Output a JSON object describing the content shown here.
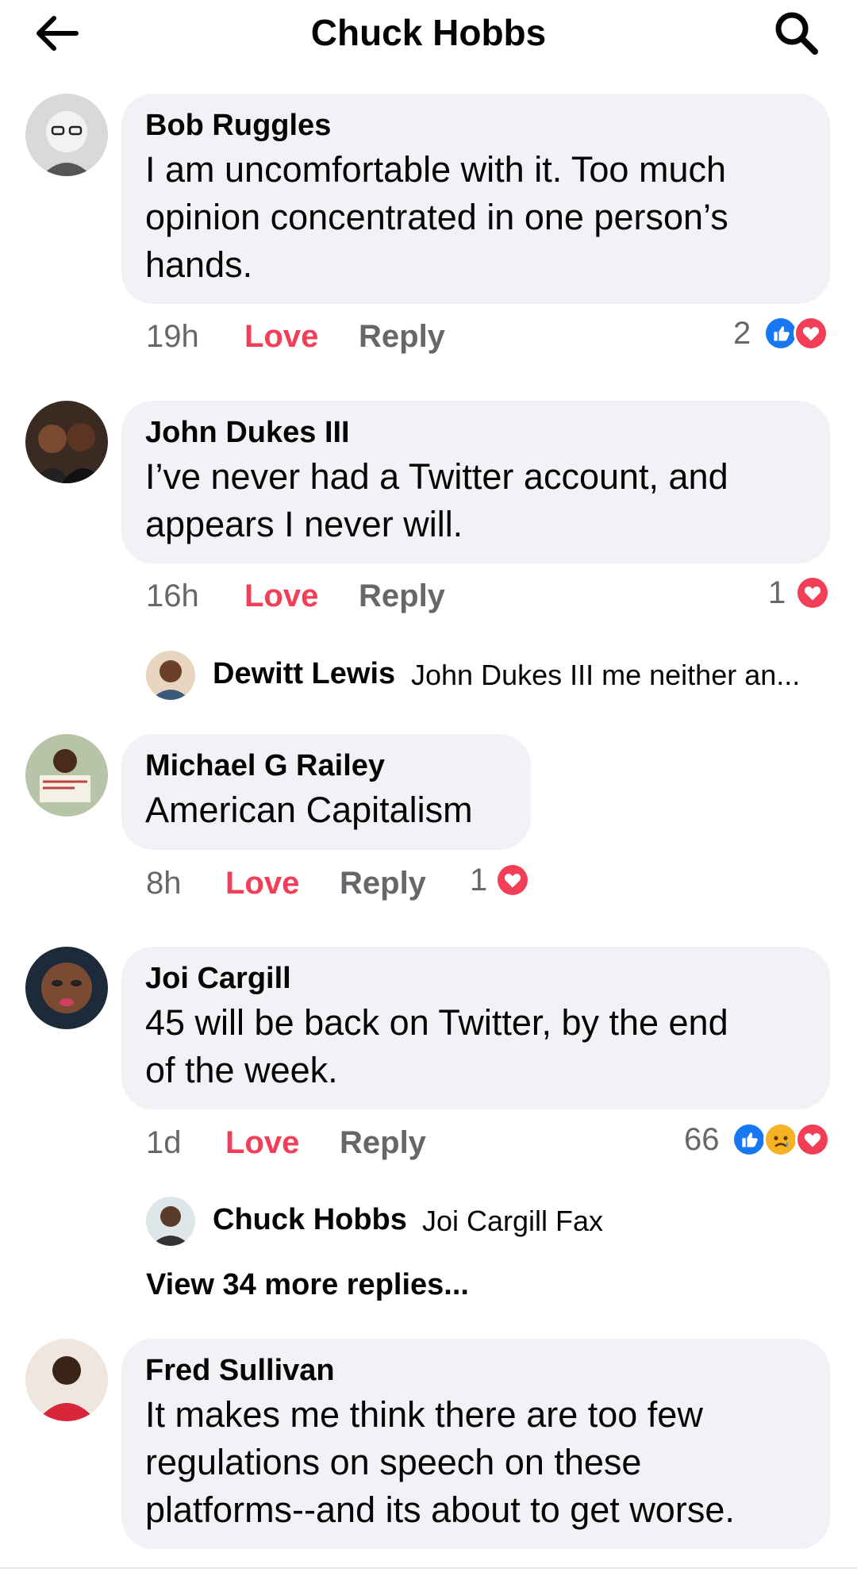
{
  "header": {
    "title": "Chuck Hobbs"
  },
  "colors": {
    "love": "#f33e58",
    "like_blue": "#1877f2",
    "bubble": "#f0f2f5",
    "muted": "#65676b"
  },
  "comments": [
    {
      "author": "Bob Ruggles",
      "lines": [
        "I am uncomfortable with it. Too much",
        "opinion concentrated in one person’s",
        "hands."
      ],
      "time": "19h",
      "love_label": "Love",
      "reply_label": "Reply",
      "reaction_count": "2",
      "reactions": [
        "like-icon",
        "love-icon"
      ]
    },
    {
      "author": "John Dukes III",
      "lines": [
        "I’ve never had a Twitter account, and",
        "appears I never will."
      ],
      "time": "16h",
      "love_label": "Love",
      "reply_label": "Reply",
      "reaction_count": "1",
      "reactions": [
        "love-icon"
      ],
      "reply_preview": {
        "author": "Dewitt Lewis",
        "text": "John Dukes III me neither an..."
      }
    },
    {
      "author": "Michael G Railey",
      "lines": [
        "American Capitalism"
      ],
      "time": "8h",
      "love_label": "Love",
      "reply_label": "Reply",
      "reaction_count": "1",
      "reactions": [
        "love-icon"
      ]
    },
    {
      "author": "Joi Cargill",
      "lines": [
        "45 will be back on Twitter, by the end",
        "of the week."
      ],
      "time": "1d",
      "love_label": "Love",
      "reply_label": "Reply",
      "reaction_count": "66",
      "reactions": [
        "like-icon",
        "sad-icon",
        "love-icon"
      ],
      "reply_preview": {
        "author": "Chuck Hobbs",
        "text": "Joi Cargill Fax"
      },
      "view_more": "View 34 more replies..."
    },
    {
      "author": "Fred Sullivan",
      "lines": [
        "It makes me think there are too few",
        "regulations on speech on these",
        "platforms--and its about to get worse."
      ]
    }
  ]
}
